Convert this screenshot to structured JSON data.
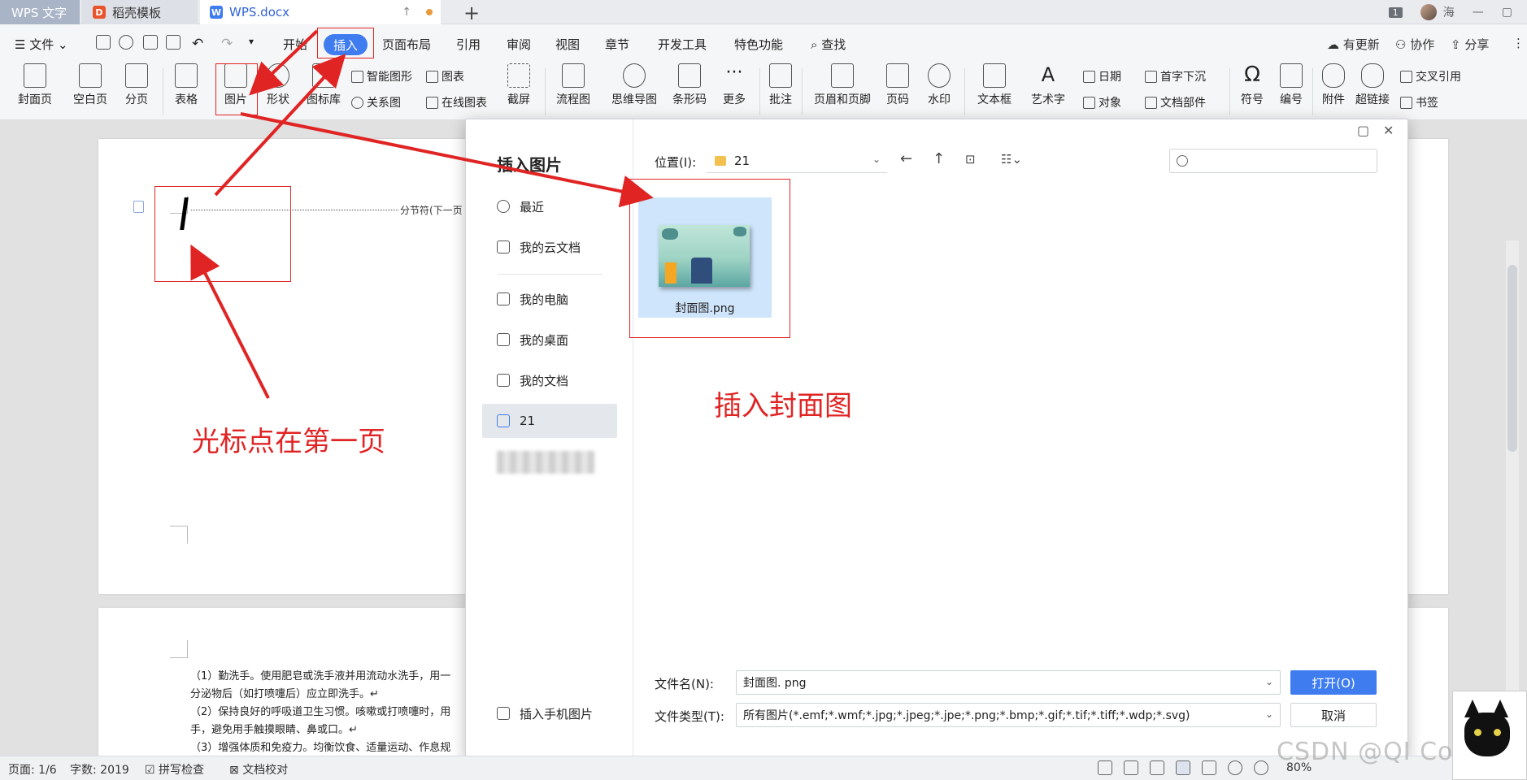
{
  "tabs": [
    {
      "label": "WPS 文字"
    },
    {
      "label": "稻壳模板"
    },
    {
      "label": "WPS.docx"
    }
  ],
  "window": {
    "badge": "1",
    "user": "海"
  },
  "menu": {
    "file": "文件",
    "items": [
      "开始",
      "插入",
      "页面布局",
      "引用",
      "审阅",
      "视图",
      "章节",
      "开发工具",
      "特色功能"
    ],
    "active": "插入",
    "search": "查找",
    "update": "有更新",
    "collab": "协作",
    "share": "分享"
  },
  "ribbon": {
    "cover": "封面页",
    "blank": "空白页",
    "pagebreak": "分页",
    "table": "表格",
    "picture": "图片",
    "shape": "形状",
    "iconlib": "图标库",
    "smartshape": "智能图形",
    "chart": "图表",
    "relation": "关系图",
    "onlinechart": "在线图表",
    "screenshot": "截屏",
    "flowchart": "流程图",
    "mindmap": "思维导图",
    "barcode": "条形码",
    "more": "更多",
    "comment": "批注",
    "headerfooter": "页眉和页脚",
    "pagenum": "页码",
    "watermark": "水印",
    "textbox": "文本框",
    "wordart": "艺术字",
    "date": "日期",
    "object": "对象",
    "dropcap": "首字下沉",
    "docpart": "文档部件",
    "symbol": "符号",
    "numbering": "编号",
    "attachment": "附件",
    "hyperlink": "超链接",
    "crossref": "交叉引用",
    "bookmark": "书签"
  },
  "document": {
    "section_break": "分节符(下一页",
    "lines": [
      "（1）勤洗手。使用肥皂或洗手液并用流动水洗手，用一",
      "分泌物后（如打喷嚏后）应立即洗手。↵",
      "（2）保持良好的呼吸道卫生习惯。咳嗽或打喷嚏时，用",
      "手，避免用手触摸眼睛、鼻或口。↵",
      "（3）增强体质和免疫力。均衡饮食、适量运动、作息规"
    ]
  },
  "dialog": {
    "title": "插入图片",
    "sidebar": [
      "最近",
      "我的云文档",
      "我的电脑",
      "我的桌面",
      "我的文档",
      "21"
    ],
    "sidebar_active": "21",
    "phone": "插入手机图片",
    "location_label": "位置(I):",
    "location_value": "21",
    "file": {
      "name": "封面图.png"
    },
    "filename_label": "文件名(N):",
    "filename_value": "封面图. png",
    "filetype_label": "文件类型(T):",
    "filetype_value": "所有图片(*.emf;*.wmf;*.jpg;*.jpeg;*.jpe;*.png;*.bmp;*.gif;*.tif;*.tiff;*.wdp;*.svg)",
    "open": "打开(O)",
    "cancel": "取消"
  },
  "annotations": {
    "cursor_note": "光标点在第一页",
    "insert_note": "插入封面图",
    "color": "#e02424"
  },
  "status": {
    "page": "页面: 1/6",
    "words": "字数: 2019",
    "spell": "拼写检查",
    "proof": "文档校对",
    "zoom": "80%"
  },
  "watermark_text": "CSDN @QI Correct"
}
